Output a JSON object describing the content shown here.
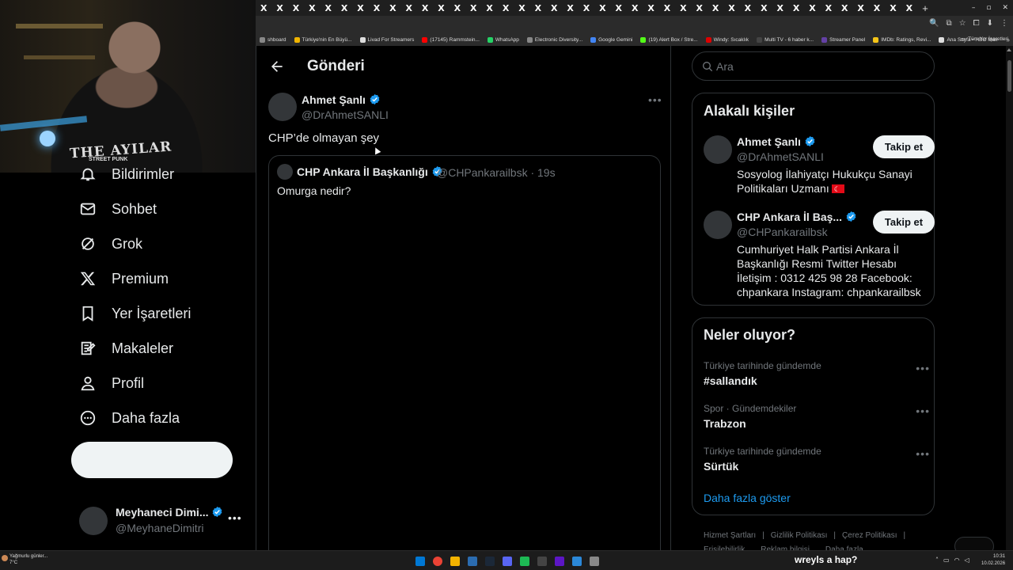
{
  "browser": {
    "tab_count": 41,
    "tab_glyph": "X",
    "new_tab": "+",
    "window_controls": [
      "–",
      "▫",
      "✕"
    ],
    "toolbar_icons": [
      "🔍",
      "⧉",
      "☆",
      "⧠",
      "⬇",
      "⋮"
    ],
    "bookmarks": [
      {
        "label": "shboard",
        "color": "#888"
      },
      {
        "label": "Türkiye'nin En Büyü...",
        "color": "#f0b400"
      },
      {
        "label": "Livad For Streamers",
        "color": "#ddd"
      },
      {
        "label": "(17145) Rammstein...",
        "color": "#ff0000"
      },
      {
        "label": "WhatsApp",
        "color": "#25d366"
      },
      {
        "label": "Electronic Diversity...",
        "color": "#888"
      },
      {
        "label": "Google Gemini",
        "color": "#4285f4"
      },
      {
        "label": "(19) Alert Box / Stre...",
        "color": "#53fc18"
      },
      {
        "label": "Windy: Sıcaklık",
        "color": "#d00"
      },
      {
        "label": "Multi TV - 6 haber k...",
        "color": "#444"
      },
      {
        "label": "Streamer Panel",
        "color": "#6441a5"
      },
      {
        "label": "IMDb: Ratings, Revi...",
        "color": "#f5c518"
      },
      {
        "label": "Ana Sayfa • HBO Max",
        "color": "#ddd"
      }
    ],
    "bookmarks_overflow": "»",
    "all_bookmarks": "Tüm Yer İşaretleri"
  },
  "webcam": {
    "shirt_text": "THE AYILAR",
    "shirt_subtext": "STREET PUNK"
  },
  "nav": {
    "items": [
      {
        "label": "Bildirimler",
        "icon": "bell-icon"
      },
      {
        "label": "Sohbet",
        "icon": "mail-icon"
      },
      {
        "label": "Grok",
        "icon": "grok-icon"
      },
      {
        "label": "Premium",
        "icon": "x-logo-icon"
      },
      {
        "label": "Yer İşaretleri",
        "icon": "bookmark-icon"
      },
      {
        "label": "Makaleler",
        "icon": "article-icon"
      },
      {
        "label": "Profil",
        "icon": "person-icon"
      },
      {
        "label": "Daha fazla",
        "icon": "more-circle-icon"
      }
    ],
    "post_button_label": ""
  },
  "account": {
    "name": "Meyhaneci Dimi...",
    "handle": "@MeyhaneDimitri",
    "more": "•••"
  },
  "main": {
    "title": "Gönderi",
    "tweet": {
      "author_name": "Ahmet Şanlı",
      "author_handle": "@DrAhmetSANLI",
      "text": "CHP’de olmayan şey",
      "more": "•••"
    },
    "quote": {
      "name": "CHP Ankara İl Başkanlığı",
      "handle_time": "@CHPankarailbsk · 19s",
      "text": "Omurga nedir?"
    }
  },
  "sidebar": {
    "search_placeholder": "Ara",
    "related_title": "Alakalı kişiler",
    "people": [
      {
        "name": "Ahmet Şanlı",
        "handle": "@DrAhmetSANLI",
        "bio": "Sosyolog İlahiyatçı Hukukçu Sanayi Politikaları Uzmanı",
        "follow": "Takip et"
      },
      {
        "name": "CHP Ankara İl Baş...",
        "handle": "@CHPankarailbsk",
        "bio": "Cumhuriyet Halk Partisi Ankara İl Başkanlığı Resmi Twitter Hesabı İletişim : 0312 425 98 28 Facebook: chpankara Instagram: chpankarailbsk",
        "follow": "Takip et"
      }
    ],
    "trends_title": "Neler oluyor?",
    "trends": [
      {
        "meta": "Türkiye tarihinde gündemde",
        "name": "#sallandık"
      },
      {
        "meta": "Spor · Gündemdekiler",
        "name": "Trabzon"
      },
      {
        "meta": "Türkiye tarihinde gündemde",
        "name": "Sürtük"
      }
    ],
    "show_more": "Daha fazla göster",
    "footer": [
      "Hizmet Şartları",
      "Gizlilik Politikası",
      "Çerez Politikası"
    ],
    "footer_row2": [
      "Erişilebilirlik",
      "Reklam bilgisi",
      "Daha fazla"
    ]
  },
  "taskbar": {
    "weather_text": "Yağmurlu günler...",
    "weather_temp": "7°C",
    "ticker": "wreyls   a hap?",
    "time": "10:31",
    "date": "10.02.2026",
    "apps": [
      "#0078d4",
      "#ea4335",
      "#f4b400",
      "#2b6cb0",
      "#1b2838",
      "#5865f2",
      "#1db954",
      "#444",
      "#5c16c5",
      "#2b88d8",
      "#888"
    ]
  },
  "colors": {
    "accent": "#1d9bf0",
    "verified": "#1d9bf0",
    "background": "#000000",
    "border": "#2f3336",
    "secondary_text": "#71767b"
  }
}
